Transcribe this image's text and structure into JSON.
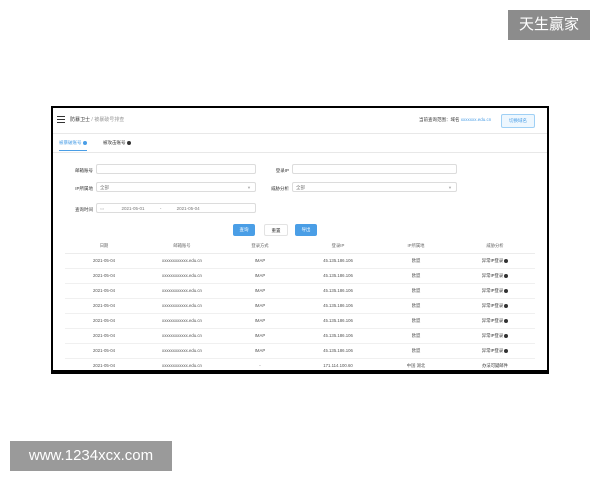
{
  "watermarks": {
    "top": "天生赢家",
    "bottom": "www.1234xcx.com"
  },
  "header": {
    "app": "防暴卫士",
    "sep": "/",
    "page": "被暴破号排查",
    "range_label": "当前查询范围：域名",
    "range_value": "xxxxxxx.edu.cn",
    "switch_button": "切换域名"
  },
  "tabs": [
    {
      "label": "被暴破账号"
    },
    {
      "label": "被攻击账号"
    }
  ],
  "form": {
    "account_label": "邮箱账号",
    "account_value": "",
    "ip_label": "登录IP",
    "ip_value": "",
    "ip_region_label": "IP所属地",
    "ip_region_value": "全部",
    "threat_label": "威胁分析",
    "threat_value": "全部",
    "time_label": "查询时间",
    "date_start": "2021-05-01",
    "date_sep": "-",
    "date_end": "2021-05-04"
  },
  "actions": {
    "query": "查询",
    "reset": "重置",
    "export": "导出"
  },
  "table": {
    "headers": [
      "日期",
      "邮箱账号",
      "登录方式",
      "登录IP",
      "IP所属地",
      "威胁分析"
    ],
    "rows": [
      [
        "2021-05-04",
        "xxxxxxxxxxxx.edu.cn",
        "IMAP",
        "45.135.186.106",
        "欧盟",
        "异常IP登录"
      ],
      [
        "2021-05-04",
        "xxxxxxxxxxxx.edu.cn",
        "IMAP",
        "45.135.186.106",
        "欧盟",
        "异常IP登录"
      ],
      [
        "2021-05-04",
        "xxxxxxxxxxxx.edu.cn",
        "IMAP",
        "45.135.186.106",
        "欧盟",
        "异常IP登录"
      ],
      [
        "2021-05-04",
        "xxxxxxxxxxxx.edu.cn",
        "IMAP",
        "45.135.186.106",
        "欧盟",
        "异常IP登录"
      ],
      [
        "2021-05-04",
        "xxxxxxxxxxxx.edu.cn",
        "IMAP",
        "45.135.186.106",
        "欧盟",
        "异常IP登录"
      ],
      [
        "2021-05-04",
        "xxxxxxxxxxxx.edu.cn",
        "IMAP",
        "45.135.186.106",
        "欧盟",
        "异常IP登录"
      ],
      [
        "2021-05-04",
        "xxxxxxxxxxxx.edu.cn",
        "IMAP",
        "45.135.186.106",
        "欧盟",
        "异常IP登录"
      ],
      [
        "2021-05-04",
        "xxxxxxxxxxxx.edu.cn",
        "-",
        "171.114.100.60",
        "中国 湖北",
        "办法可疑邮件"
      ]
    ]
  },
  "colors": {
    "accent": "#4a9ee6",
    "frame": "#000000"
  }
}
